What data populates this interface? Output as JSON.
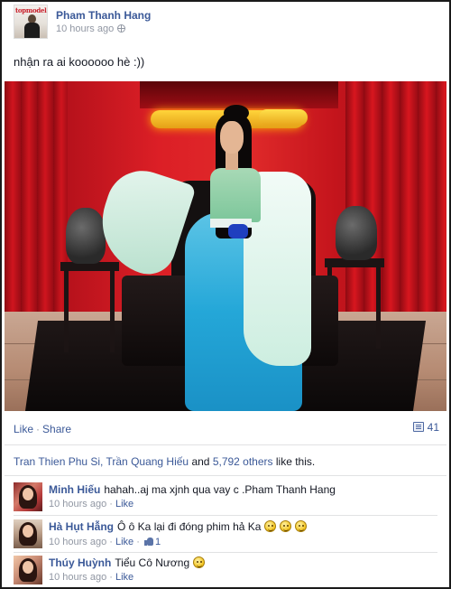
{
  "post": {
    "author": "Pham Thanh Hang",
    "timestamp": "10 hours ago",
    "privacy_icon": "globe-icon",
    "text": "nhận ra ai koooooo hè :))",
    "avatar_logo": "topmodel"
  },
  "actions": {
    "like_label": "Like",
    "separator": "·",
    "share_label": "Share",
    "comment_count": "41",
    "comment_icon": "comment-icon"
  },
  "likes": {
    "names": "Tran Thien Phu Si, Trần Quang Hiếu",
    "connector": " and ",
    "others": "5,792 others",
    "suffix": " like this."
  },
  "comments": [
    {
      "author": "Minh Hiếu",
      "text": "hahah..aj ma xjnh qua vay c .Pham Thanh Hang",
      "timestamp": "10 hours ago",
      "like_label": "Like"
    },
    {
      "author": "Hà Hụt Hẫng",
      "text": "Ô ô Ka lại đi đóng phim hả Ka",
      "timestamp": "10 hours ago",
      "like_label": "Like",
      "like_count": "1",
      "emoji_icons": [
        "smile-emoji",
        "smile-emoji",
        "smile-emoji"
      ]
    },
    {
      "author": "Thúy Huỳnh",
      "text": "Tiểu Cô Nương",
      "timestamp": "10 hours ago",
      "like_label": "Like",
      "emoji_icons": [
        "tongue-emoji"
      ]
    }
  ],
  "colors": {
    "link": "#3b5998",
    "meta": "#9197a3",
    "text": "#141823",
    "divider": "#e1e2e3"
  }
}
